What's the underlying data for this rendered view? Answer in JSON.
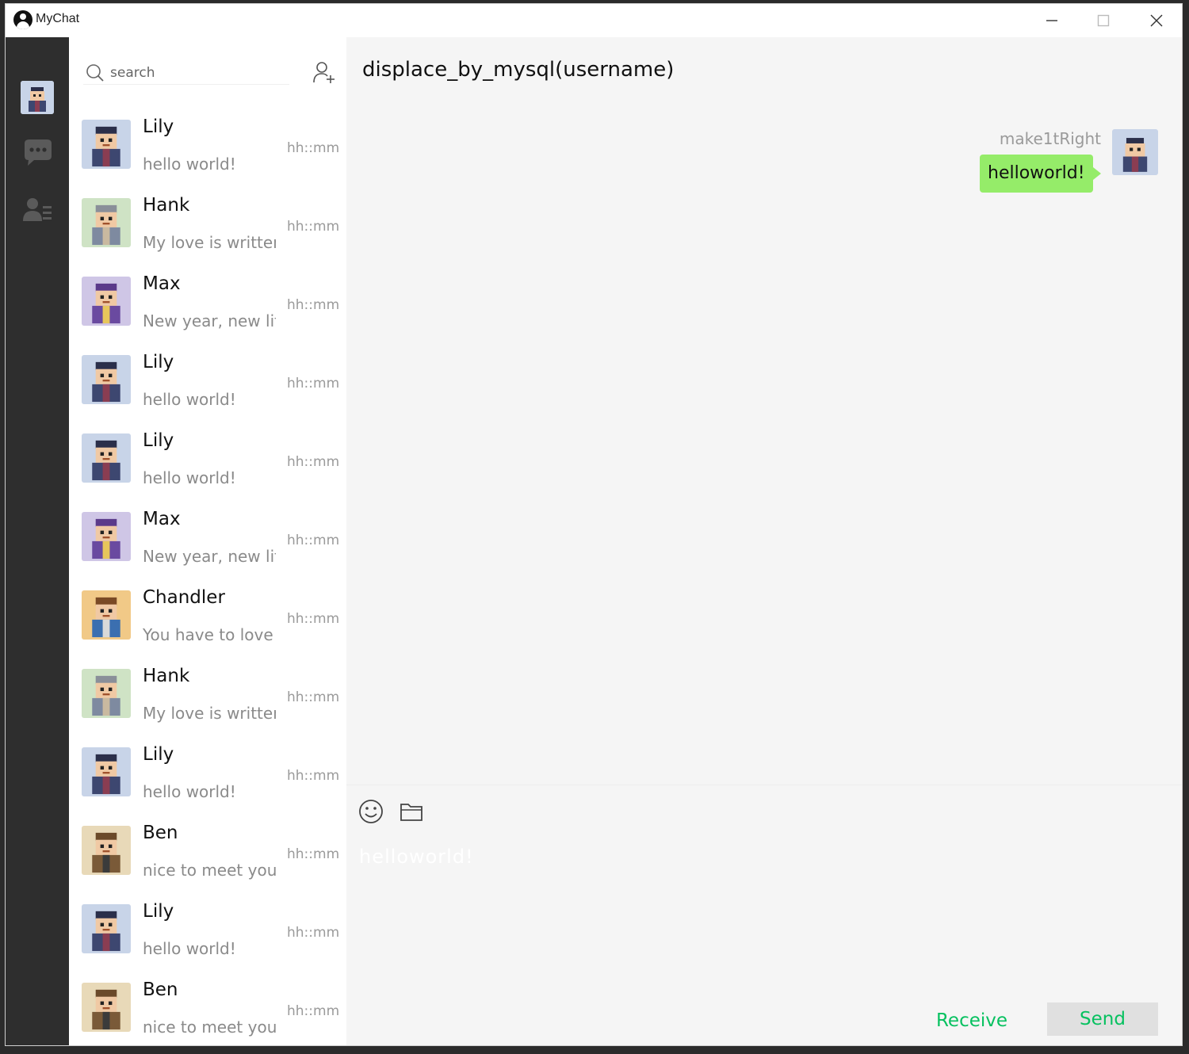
{
  "window": {
    "title": "MyChat"
  },
  "search": {
    "placeholder": "search"
  },
  "chat": {
    "title": "displace_by_mysql(username)",
    "messages": [
      {
        "sender": "make1tRight",
        "text": "helloworld!",
        "direction": "outgoing",
        "bubble_color": "#95ec69"
      }
    ],
    "draft": "helloworld!"
  },
  "contacts": [
    {
      "name": "Lily",
      "preview": "hello world!",
      "time": "hh::mm",
      "avatar": "lily"
    },
    {
      "name": "Hank",
      "preview": "My love is written",
      "time": "hh::mm",
      "avatar": "hank"
    },
    {
      "name": "Max",
      "preview": "New year, new life",
      "time": "hh::mm",
      "avatar": "max"
    },
    {
      "name": "Lily",
      "preview": "hello world!",
      "time": "hh::mm",
      "avatar": "lily"
    },
    {
      "name": "Lily",
      "preview": "hello world!",
      "time": "hh::mm",
      "avatar": "lily"
    },
    {
      "name": "Max",
      "preview": "New year, new life",
      "time": "hh::mm",
      "avatar": "max"
    },
    {
      "name": "Chandler",
      "preview": "You have to love y",
      "time": "hh::mm",
      "avatar": "chandler"
    },
    {
      "name": "Hank",
      "preview": "My love is written",
      "time": "hh::mm",
      "avatar": "hank"
    },
    {
      "name": "Lily",
      "preview": "hello world!",
      "time": "hh::mm",
      "avatar": "lily"
    },
    {
      "name": "Ben",
      "preview": "nice to meet you",
      "time": "hh::mm",
      "avatar": "ben"
    },
    {
      "name": "Lily",
      "preview": "hello world!",
      "time": "hh::mm",
      "avatar": "lily"
    },
    {
      "name": "Ben",
      "preview": "nice to meet you",
      "time": "hh::mm",
      "avatar": "ben"
    }
  ],
  "buttons": {
    "receive": "Receive",
    "send": "Send"
  },
  "icons": {
    "sidebar": [
      "chat-bubble-icon",
      "contacts-icon"
    ],
    "toolbar": [
      "emoji-icon",
      "folder-icon"
    ],
    "window": [
      "minimize-icon",
      "maximize-icon",
      "close-icon"
    ]
  },
  "colors": {
    "accent": "#07c160",
    "sidebar": "#2e2e2e",
    "bubble": "#95ec69"
  }
}
